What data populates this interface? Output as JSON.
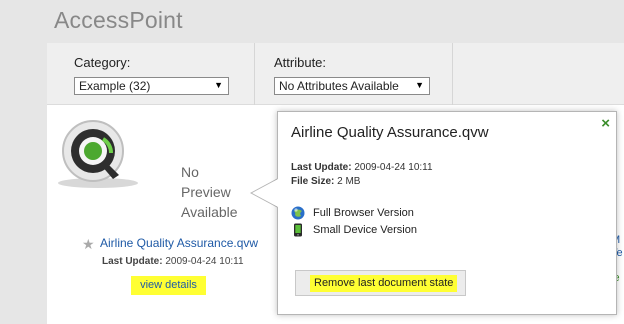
{
  "app": {
    "title": "AccessPoint"
  },
  "filters": {
    "category_label": "Category:",
    "category_value": "Example (32)",
    "attribute_label": "Attribute:",
    "attribute_value": "No Attributes Available"
  },
  "document": {
    "no_preview_line1": "No",
    "no_preview_line2": "Preview",
    "no_preview_line3": "Available",
    "link_text": "Airline Quality Assurance.qvw",
    "last_update_label": "Last Update:",
    "last_update_value": "2009-04-24 10:11",
    "view_details": "view details",
    "star_icon": "star-icon",
    "logo_icon": "qlikview-logo-icon"
  },
  "popup": {
    "title": "Airline Quality Assurance.qvw",
    "close_glyph": "×",
    "last_update_label": "Last Update:",
    "last_update_value": "2009-04-24 10:11",
    "file_size_label": "File Size:",
    "file_size_value": "2 MB",
    "versions": [
      {
        "label": "Full Browser Version",
        "icon": "browser-globe-icon"
      },
      {
        "label": "Small Device Version",
        "icon": "mobile-device-icon"
      }
    ],
    "remove_button": "Remove last document state"
  },
  "partial_right": {
    "line1": "M",
    "line2": "Te",
    "line3": "ie"
  },
  "colors": {
    "highlight": "#ffff33",
    "link": "#1f5aa6",
    "close": "#3a8d2a"
  }
}
